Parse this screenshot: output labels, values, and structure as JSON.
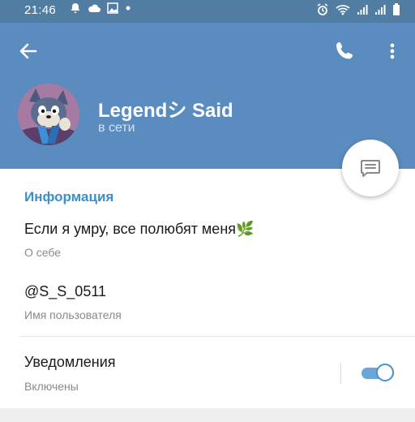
{
  "status_bar": {
    "time": "21:46",
    "left_icons": [
      "notification-icon",
      "cloud-icon",
      "image-icon",
      "dot-icon"
    ],
    "right_icons": [
      "alarm-icon",
      "wifi-icon",
      "signal-icon",
      "signal-icon",
      "battery-icon"
    ]
  },
  "header": {
    "background_color": "#5b8cbf",
    "name": "Legendシ Said",
    "status": "в сети",
    "actions": [
      "back-arrow-icon",
      "phone-icon",
      "more-vertical-icon"
    ]
  },
  "fab": {
    "icon": "message-icon"
  },
  "info": {
    "title": "Информация",
    "bio_value": "Если я умру, все полюбят меня",
    "bio_emoji": "🌿",
    "bio_label": "О себе",
    "username_value": "@S_S_0511",
    "username_label": "Имя пользователя",
    "notifications_value": "Уведомления",
    "notifications_label": "Включены",
    "notifications_enabled": true
  },
  "colors": {
    "accent": "#3a8fcd",
    "header": "#5b8cbf",
    "status_bar": "#527da3",
    "toggle": "#6aa6d9"
  }
}
